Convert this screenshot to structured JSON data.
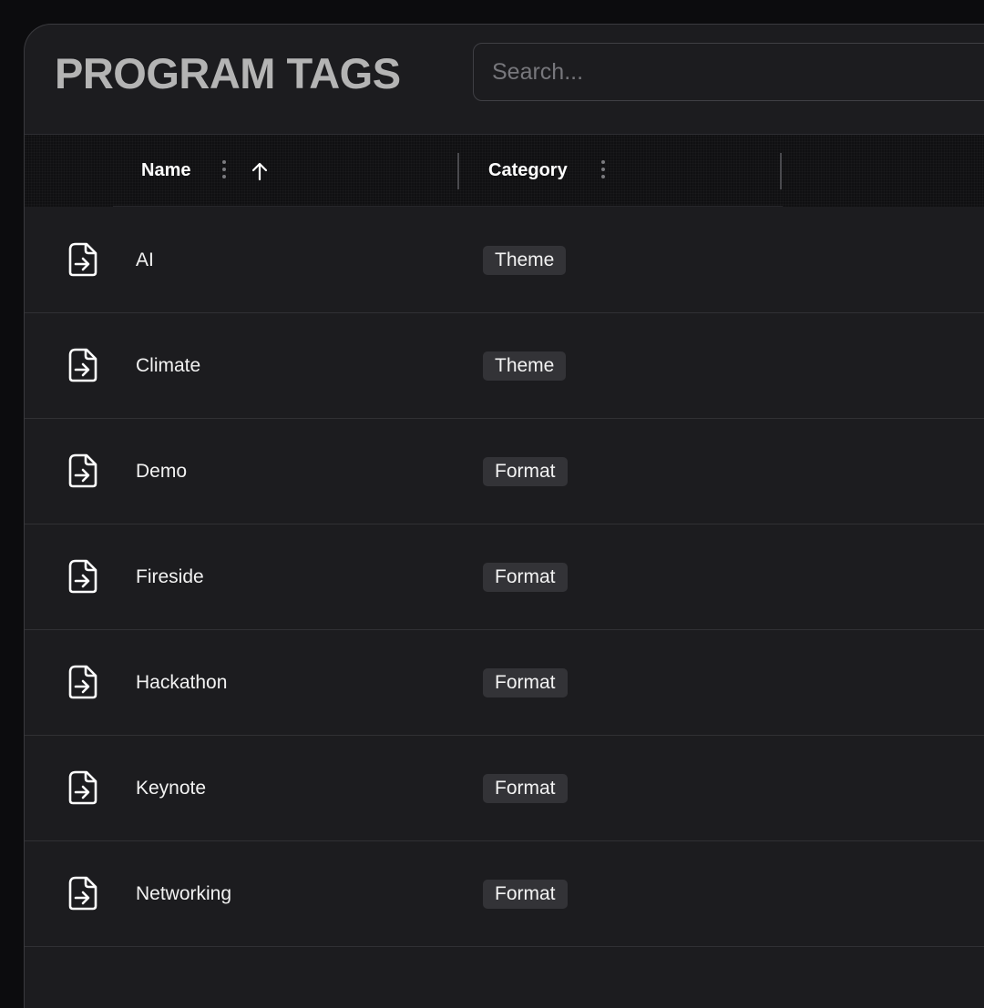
{
  "header": {
    "title": "PROGRAM TAGS",
    "search_placeholder": "Search...",
    "search_value": ""
  },
  "table": {
    "columns": [
      {
        "label": "Name",
        "sorted": "ascending"
      },
      {
        "label": "Category"
      }
    ],
    "rows": [
      {
        "name": "AI",
        "category": "Theme",
        "icon": "file-import-icon"
      },
      {
        "name": "Climate",
        "category": "Theme",
        "icon": "file-import-icon"
      },
      {
        "name": "Demo",
        "category": "Format",
        "icon": "file-import-icon"
      },
      {
        "name": "Fireside",
        "category": "Format",
        "icon": "file-import-icon"
      },
      {
        "name": "Hackathon",
        "category": "Format",
        "icon": "file-import-icon"
      },
      {
        "name": "Keynote",
        "category": "Format",
        "icon": "file-import-icon"
      },
      {
        "name": "Networking",
        "category": "Format",
        "icon": "file-import-icon"
      },
      {
        "name": "",
        "category": "",
        "icon": ""
      }
    ]
  },
  "colors": {
    "page_background": "#0c0c0e",
    "panel_background": "#1c1c1f",
    "header_row_background": "#101012",
    "title_text": "#b4b4b4",
    "badge_background": "#333337",
    "text": "#f2f2f2"
  }
}
